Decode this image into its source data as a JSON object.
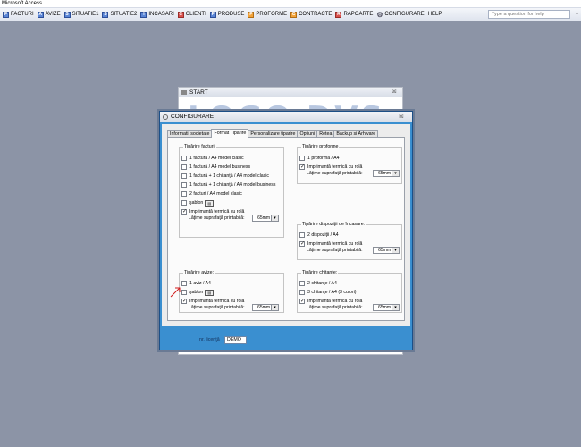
{
  "app": {
    "title": "Microsoft Access"
  },
  "menu": {
    "items": [
      {
        "label": "FACTURI",
        "icon": "document-icon"
      },
      {
        "label": "AVIZE",
        "icon": "document-icon"
      },
      {
        "label": "SITUATIE1",
        "icon": "report-icon"
      },
      {
        "label": "SITUATIE2",
        "icon": "report-icon"
      },
      {
        "label": "INCASARI",
        "icon": "report-icon"
      },
      {
        "label": "CLIENTI",
        "icon": "clients-icon"
      },
      {
        "label": "PRODUSE",
        "icon": "products-icon"
      },
      {
        "label": "PROFORME",
        "icon": "proforma-icon"
      },
      {
        "label": "CONTRACTE",
        "icon": "contract-icon"
      },
      {
        "label": "RAPOARTE",
        "icon": "report-icon"
      },
      {
        "label": "CONFIGURARE",
        "icon": "gear-icon"
      },
      {
        "label": "HELP",
        "icon": ""
      }
    ],
    "help_placeholder": "Type a question for help"
  },
  "start_window": {
    "title": "START",
    "logo_text": "LOGO DVS"
  },
  "config": {
    "title": "CONFIGURARE",
    "tabs": [
      "Informatii societate",
      "Format Tiparire",
      "Personalizare tiparire",
      "Optiuni",
      "Retea",
      "Backup si Arhivare"
    ],
    "active_tab": "Format Tiparire",
    "facturi": {
      "label": "Tipărire facturi:",
      "options": [
        {
          "label": "1 factură / A4 model clasic",
          "checked": false
        },
        {
          "label": "1 factură / A4 model business",
          "checked": false
        },
        {
          "label": "1 factură + 1 chitanţă / A4 model clasic",
          "checked": false
        },
        {
          "label": "1 factură + 1 chitanţă / A4 model business",
          "checked": false
        },
        {
          "label": "2 facturi / A4 model clasic",
          "checked": false
        },
        {
          "label": "şablon",
          "checked": false
        },
        {
          "label": "Imprimantă termică cu rolă",
          "checked": true
        }
      ],
      "width_label": "Lăţime suprafaţă printabilă:",
      "width_value": "65mm"
    },
    "proforme": {
      "label": "Tipărire proforme",
      "options": [
        {
          "label": "1 proformă / A4",
          "checked": false
        },
        {
          "label": "Imprimantă termică cu rolă",
          "checked": true
        }
      ],
      "width_label": "Lăţime suprafaţă printabilă:",
      "width_value": "65mm"
    },
    "dispozitii": {
      "label": "Tipărire dispoziţii de încasare:",
      "options": [
        {
          "label": "2 dispoziţii / A4",
          "checked": false
        },
        {
          "label": "Imprimantă termică cu rolă",
          "checked": true
        }
      ],
      "width_label": "Lăţime suprafaţă printabilă:",
      "width_value": "65mm"
    },
    "avize": {
      "label": "Tipărire avize:",
      "options": [
        {
          "label": "1 aviz / A4",
          "checked": false
        },
        {
          "label": "şablon",
          "checked": false
        },
        {
          "label": "Imprimantă termică cu rolă",
          "checked": true
        }
      ],
      "width_label": "Lăţime suprafaţă printabilă:",
      "width_value": "65mm"
    },
    "chitante": {
      "label": "Tipărire chitanţe:",
      "options": [
        {
          "label": "2 chitanţe / A4",
          "checked": false
        },
        {
          "label": "3 chitanţe / A4 (3 culori)",
          "checked": false
        },
        {
          "label": "Imprimantă termică cu rolă",
          "checked": true
        }
      ],
      "width_label": "Lăţime suprafaţă printabilă:",
      "width_value": "65mm"
    },
    "licence_label": "nr. licenţă",
    "licence_value": "DEMO"
  },
  "colors": {
    "desktop": "#8c94a6",
    "dialog_accent": "#3a8fd0",
    "arrow": "#d11a1a"
  }
}
